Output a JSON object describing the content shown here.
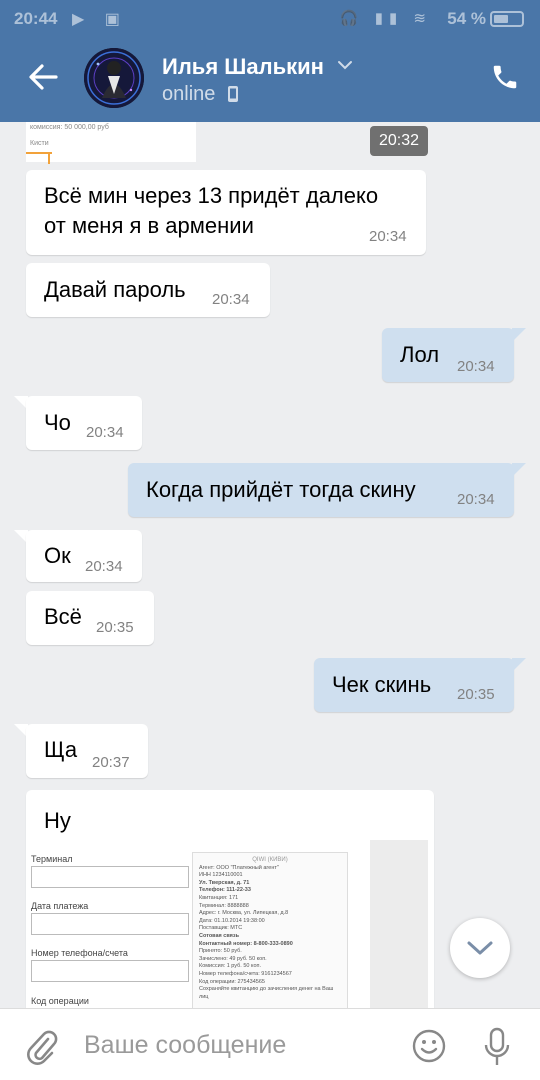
{
  "status_bar": {
    "time": "20:44",
    "battery_percent": "54 %"
  },
  "header": {
    "contact_name": "Илья Шалькин",
    "contact_status": "online"
  },
  "messages": [
    {
      "direction": "in",
      "text": "Всё мин через 13 придёт далеко\nот меня я в армении",
      "time": "20:34"
    },
    {
      "direction": "in",
      "text": "Давай пароль",
      "time": "20:34"
    },
    {
      "direction": "out",
      "text": "Лол",
      "time": "20:34"
    },
    {
      "direction": "in",
      "text": "Чо",
      "time": "20:34"
    },
    {
      "direction": "out",
      "text": "Когда прийдёт тогда скину",
      "time": "20:34"
    },
    {
      "direction": "in",
      "text": "Ок",
      "time": "20:34"
    },
    {
      "direction": "in",
      "text": "Всё",
      "time": "20:35"
    },
    {
      "direction": "out",
      "text": "Чек скинь",
      "time": "20:35"
    },
    {
      "direction": "in",
      "text": "Ща",
      "time": "20:37"
    },
    {
      "direction": "in",
      "text": "Ну",
      "time": ""
    }
  ],
  "top_image": {
    "time": "20:32",
    "caption_line": "комиссия: 50 000,00 руб",
    "caption_line2": "Кисти"
  },
  "receipt_form": {
    "labels": [
      "Терминал",
      "Дата платежа",
      "Номер телефона/счета",
      "Код операции"
    ]
  },
  "receipt": {
    "header": "QIWI (КИВИ)",
    "lines": [
      "Агент: ООО \"Платежный агент\"",
      "ИНН 1234110001",
      "Ул. Тверская, д. 71",
      "Телефон: 111-22-33",
      "Квитанция: 171",
      "Терминал: 8888888",
      "Адрес: г. Москва, ул. Липецкая, д.8",
      "Дата: 01.10.2014 19:38:00",
      "Поставщик: МТС",
      "Сотовая связь",
      "Контактный номер: 8-800-333-0890",
      "Принято: 50 руб.",
      "Зачислено: 49 руб. 50 коп.",
      "Комиссия: 1 руб. 50 коп.",
      "Номер телефона/счета: 9161234567",
      "Код операции: 275434565",
      "Сохраняйте квитанцию до зачисления денег на Ваш лиц"
    ]
  },
  "composer": {
    "placeholder": "Ваше сообщение"
  }
}
